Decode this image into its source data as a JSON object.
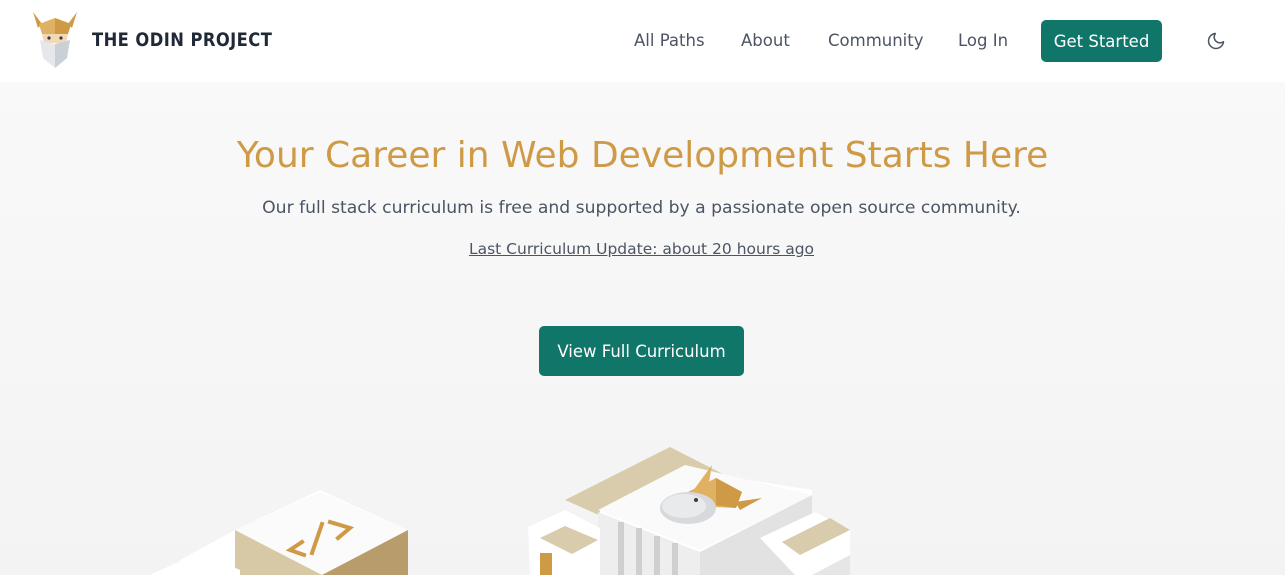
{
  "brand": {
    "name": "THE ODIN PROJECT"
  },
  "nav": {
    "links": [
      {
        "label": "All Paths"
      },
      {
        "label": "About"
      },
      {
        "label": "Community"
      },
      {
        "label": "Log In"
      }
    ],
    "cta_label": "Get Started",
    "theme_icon": "moon-icon"
  },
  "hero": {
    "title": "Your Career in Web Development Starts Here",
    "subtitle": "Our full stack curriculum is free and supported by a passionate open source community.",
    "last_update": "Last Curriculum Update: about 20 hours ago",
    "cta_label": "View Full Curriculum"
  },
  "colors": {
    "accent": "#cf9a46",
    "primary": "#11766a",
    "text": "#4b5563",
    "heading": "#1f2937"
  },
  "illustration": {
    "code_glyph": "</>",
    "icons": [
      "code-icon",
      "odin-helmet-icon"
    ]
  }
}
